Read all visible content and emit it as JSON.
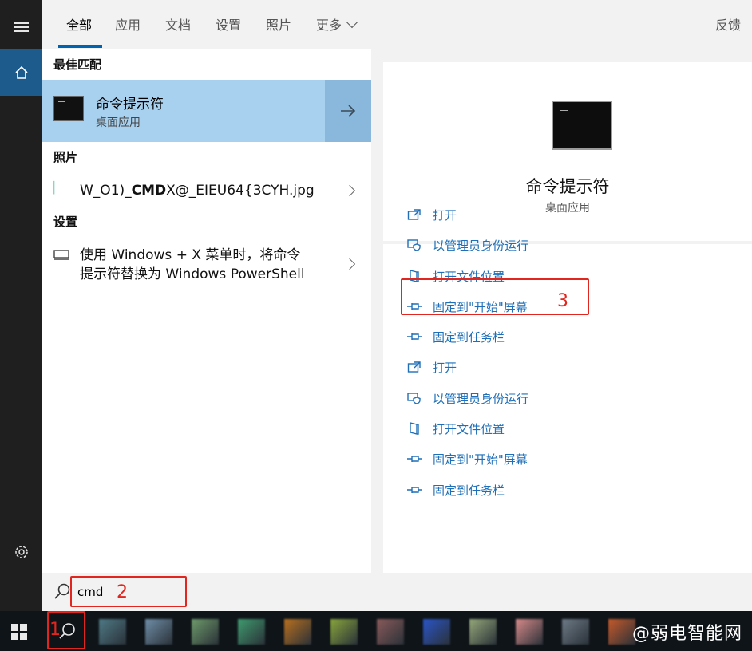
{
  "tabs": {
    "items": [
      "全部",
      "应用",
      "文档",
      "设置",
      "照片",
      "更多"
    ],
    "feedback": "反馈"
  },
  "results": {
    "best_match_header": "最佳匹配",
    "best_match": {
      "name": "命令提示符",
      "subtitle": "桌面应用"
    },
    "photos_header": "照片",
    "photo_item": {
      "prefix": "W_O1)_",
      "bold": "CMD",
      "suffix": "X@_EIEU64{3CYH.jpg"
    },
    "settings_header": "设置",
    "settings_item": {
      "line1": "使用 Windows + X 菜单时，将命令",
      "line2": "提示符替换为 Windows PowerShell"
    }
  },
  "preview": {
    "name": "命令提示符",
    "subtitle": "桌面应用",
    "actions": [
      {
        "icon": "open-icon",
        "label": "打开"
      },
      {
        "icon": "admin-shield-icon",
        "label": "以管理员身份运行"
      },
      {
        "icon": "file-location-icon",
        "label": "打开文件位置"
      },
      {
        "icon": "pin-icon",
        "label": "固定到\"开始\"屏幕"
      },
      {
        "icon": "pin-icon",
        "label": "固定到任务栏"
      },
      {
        "icon": "open-icon",
        "label": "打开"
      },
      {
        "icon": "admin-shield-icon",
        "label": "以管理员身份运行"
      },
      {
        "icon": "file-location-icon",
        "label": "打开文件位置"
      },
      {
        "icon": "pin-icon",
        "label": "固定到\"开始\"屏幕"
      },
      {
        "icon": "pin-icon",
        "label": "固定到任务栏"
      }
    ]
  },
  "search": {
    "value": "cmd"
  },
  "annotations": {
    "one": "1",
    "two": "2",
    "three": "3"
  },
  "taskbar": {
    "watermark": "@弱电智能网",
    "app_colors": [
      "#4f7a86",
      "#6f8ea8",
      "#6e9a6a",
      "#3f9b6f",
      "#b8701e",
      "#88a63b",
      "#8a5a5a",
      "#2a55c8",
      "#95a87a",
      "#d88a8a",
      "#6d7a86",
      "#c65a2a"
    ]
  },
  "colors": {
    "accent": "#0063b1",
    "link": "#1e6fb8",
    "highlight": "#a8d0ef",
    "annotation": "#e0261f"
  }
}
